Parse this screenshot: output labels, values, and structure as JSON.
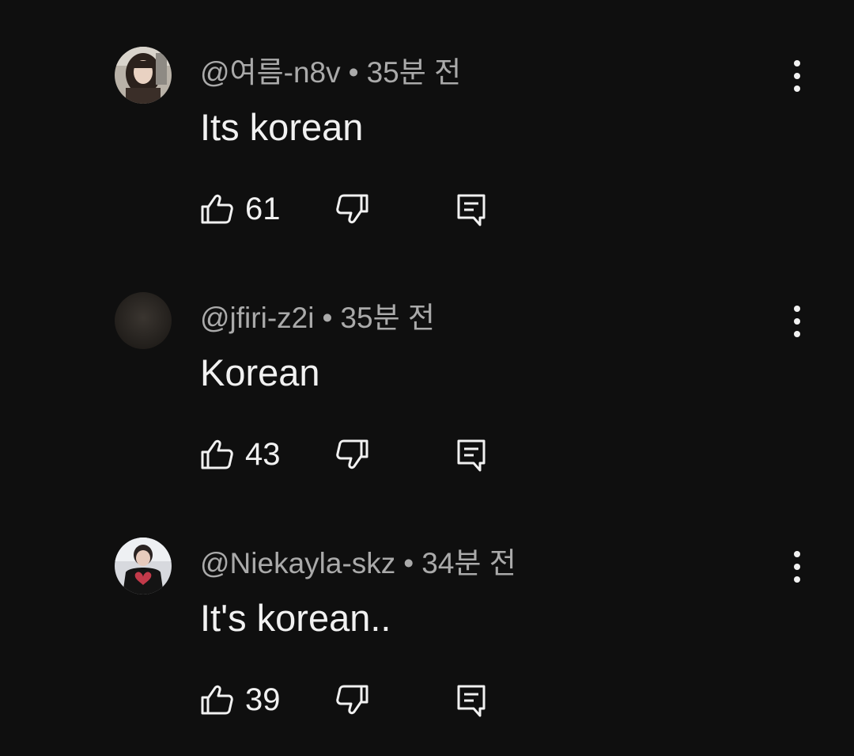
{
  "theme": {
    "background": "#0f0f0f",
    "text_primary": "#f1f1f1",
    "text_secondary": "#aaaaaa"
  },
  "comments": [
    {
      "author": "@여름-n8v",
      "separator": "•",
      "time": "35분 전",
      "text": "Its korean",
      "likes": "61",
      "avatar_icon": "avatar-photo-girl-long-hair"
    },
    {
      "author": "@jfiri-z2i",
      "separator": "•",
      "time": "35분 전",
      "text": "Korean",
      "likes": "43",
      "avatar_icon": "avatar-photo-dark"
    },
    {
      "author": "@Niekayla-skz",
      "separator": "•",
      "time": "34분 전",
      "text": "It's korean..",
      "likes": "39",
      "avatar_icon": "avatar-photo-person-heart-pose"
    }
  ],
  "icons": {
    "like": "thumbs-up-icon",
    "dislike": "thumbs-down-icon",
    "reply": "reply-comment-icon",
    "menu": "more-vertical-icon"
  }
}
